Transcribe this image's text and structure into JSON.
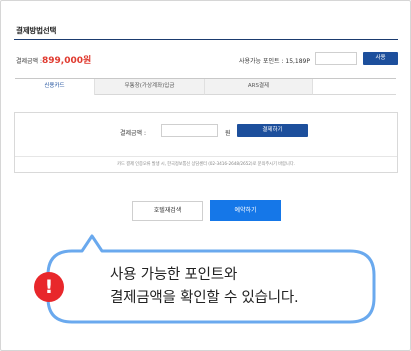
{
  "page": {
    "title": "결제방법선택"
  },
  "amount": {
    "label": "결제금액 :",
    "value": "899,000원"
  },
  "points": {
    "label": "사용가능 포인트 : 15,189P",
    "input_value": "",
    "use_label": "사용"
  },
  "tabs": [
    {
      "label": "신용카드",
      "active": true
    },
    {
      "label": "무통장(가상계좌)입금",
      "active": false
    },
    {
      "label": "ARS결제",
      "active": false
    },
    {
      "label": "",
      "active": false
    }
  ],
  "payment": {
    "label": "결제금액 :",
    "input_value": "",
    "unit": "원",
    "button_label": "결제하기",
    "notice": "카드 결제 인증오류 발생 시, 한국정보통신 상담센터 (02-3416-2648/2652)로 문의주시기 바랍니다."
  },
  "actions": {
    "hotel_search": "호텔재검색",
    "reserve": "예약하기"
  },
  "tooltip": {
    "icon": "exclamation-icon",
    "line1": "사용 가능한 포인트와",
    "line2": "결제금액을 확인할 수 있습니다."
  },
  "colors": {
    "primary": "#1d4f9c",
    "accent_blue": "#1577e8",
    "amount_red": "#e03a2f",
    "warning_red": "#e8272b",
    "bubble_border": "#6aa9ee"
  }
}
